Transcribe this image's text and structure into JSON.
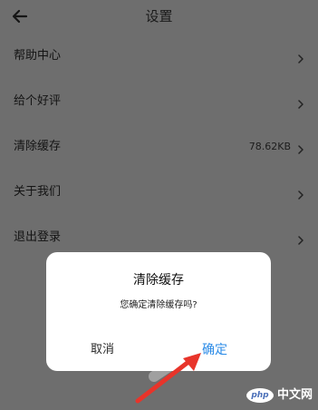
{
  "header": {
    "title": "设置",
    "back_icon": "arrow-left-icon"
  },
  "settings": {
    "items": [
      {
        "label": "帮助中心",
        "value": ""
      },
      {
        "label": "给个好评",
        "value": ""
      },
      {
        "label": "清除缓存",
        "value": "78.62KB"
      },
      {
        "label": "关于我们",
        "value": ""
      },
      {
        "label": "退出登录",
        "value": ""
      }
    ]
  },
  "dialog": {
    "title": "清除缓存",
    "message": "您确定清除缓存吗?",
    "cancel_label": "取消",
    "confirm_label": "确定"
  },
  "watermark": {
    "badge": "php",
    "text": "中文网"
  },
  "colors": {
    "overlay_background": "#6e6e6e",
    "dialog_background": "#ffffff",
    "confirm_accent": "#2b8be7",
    "annotation_arrow": "#e8342a"
  }
}
